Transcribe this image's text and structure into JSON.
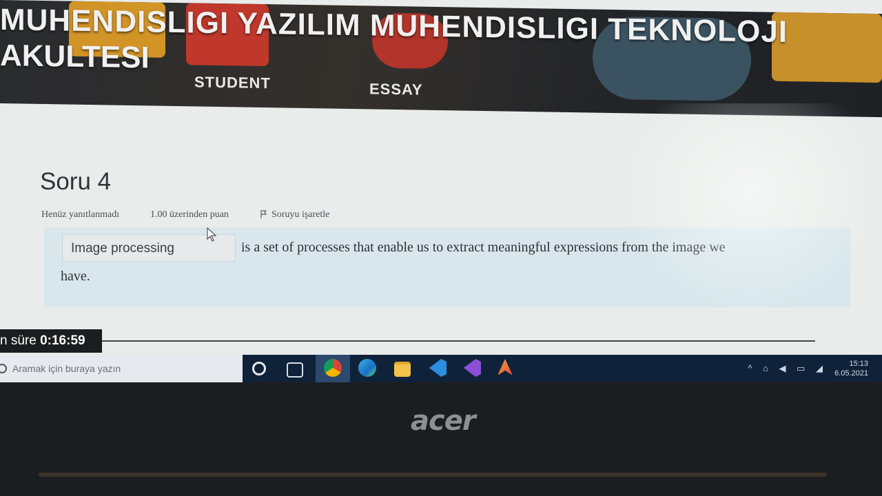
{
  "banner": {
    "line1": "MUHENDISLIGI YAZILIM MUHENDISLIGI TEKNOLOJI",
    "line2": "AKULTESI",
    "chip_student": "STUDENT",
    "chip_essay": "ESSAY"
  },
  "question": {
    "title": "Soru 4",
    "status": "Henüz yanıtlanmadı",
    "points": "1.00 üzerinden puan",
    "flag_label": "Soruyu işaretle",
    "answer_value": "Image processing",
    "text_line1": "is a set of processes that enable us to extract meaningful expressions from the image we",
    "text_line2": "have."
  },
  "timer": {
    "label": "n süre",
    "value": "0:16:59"
  },
  "taskbar": {
    "search_placeholder": "Aramak için buraya yazın",
    "time": "15:13",
    "date": "6.05.2021",
    "apps": [
      "cortana-icon",
      "task-view-icon",
      "chrome-icon",
      "edge-icon",
      "file-explorer-icon",
      "vscode-icon",
      "visual-studio-icon",
      "app-icon"
    ]
  },
  "bezel": {
    "brand": "acer"
  }
}
